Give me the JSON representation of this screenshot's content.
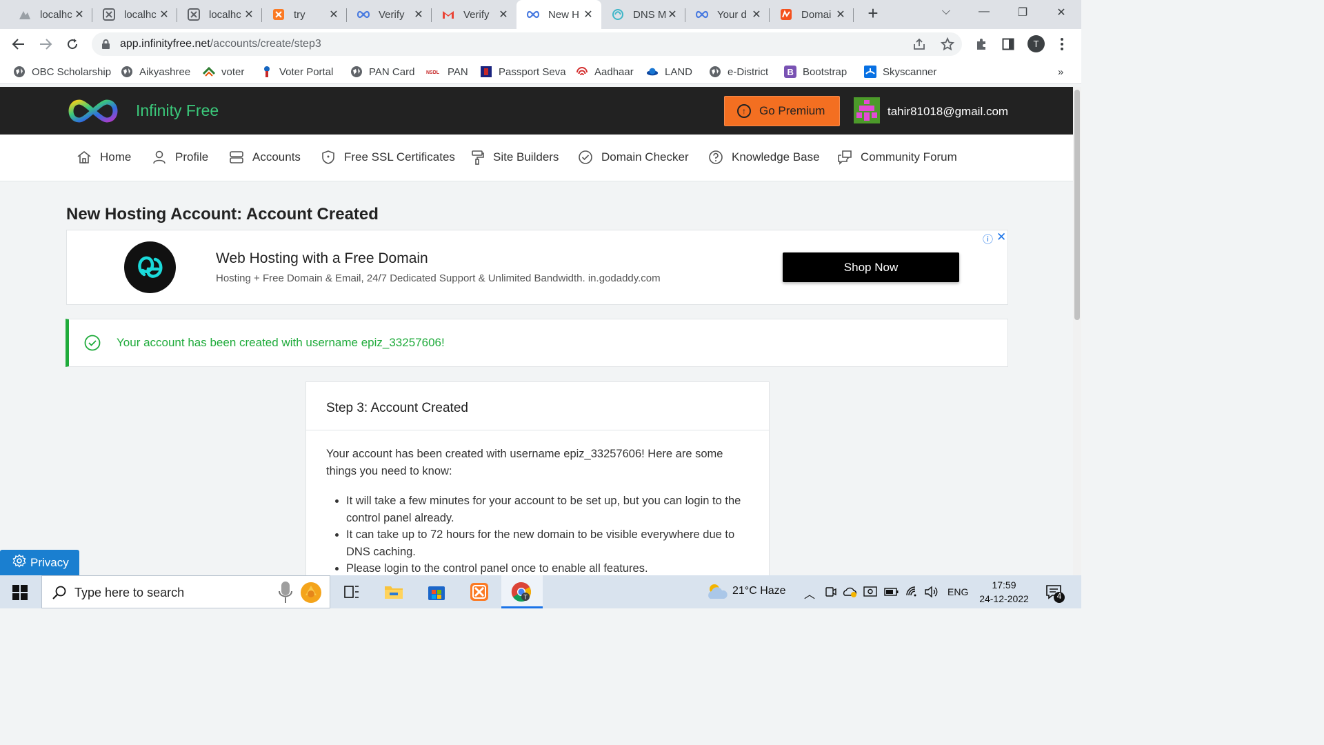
{
  "browser": {
    "tabs": [
      {
        "label": "localhc",
        "icon": "pma-icon"
      },
      {
        "label": "localhc",
        "icon": "xampp-icon"
      },
      {
        "label": "localhc",
        "icon": "xampp-icon"
      },
      {
        "label": "try",
        "icon": "xampp-orange-icon"
      },
      {
        "label": "Verify",
        "icon": "infinity-icon"
      },
      {
        "label": "Verify",
        "icon": "gmail-icon"
      },
      {
        "label": "New H",
        "icon": "infinity-icon",
        "active": true
      },
      {
        "label": "DNS M",
        "icon": "dns-icon"
      },
      {
        "label": "Your d",
        "icon": "infinity-icon"
      },
      {
        "label": "Domai",
        "icon": "domain-icon"
      }
    ],
    "url_host": "app.infinityfree.net",
    "url_path": "/accounts/create/step3",
    "profile_initial": "T",
    "bookmarks": [
      "OBC Scholarship",
      "Aikyashree",
      "voter",
      "Voter Portal",
      "PAN Card",
      "PAN",
      "Passport Seva",
      "Aadhaar",
      "LAND",
      "e-District",
      "Bootstrap",
      "Skyscanner"
    ],
    "bookmarks_overflow": "»"
  },
  "site": {
    "brand": "Infinity Free",
    "premium_label": "Go Premium",
    "user_email": "tahir81018@gmail.com",
    "nav": [
      "Home",
      "Profile",
      "Accounts",
      "Free SSL Certificates",
      "Site Builders",
      "Domain Checker",
      "Knowledge Base",
      "Community Forum"
    ]
  },
  "main": {
    "page_title": "New Hosting Account: Account Created",
    "ad": {
      "title": "Web Hosting with a Free Domain",
      "subtitle": "Hosting + Free Domain & Email, 24/7 Dedicated Support & Unlimited Bandwidth. in.godaddy.com",
      "button": "Shop Now"
    },
    "alert_text": "Your account has been created with username epiz_33257606!",
    "card": {
      "title": "Step 3: Account Created",
      "intro": "Your account has been created with username epiz_33257606! Here are some things you need to know:",
      "items": [
        "It will take a few minutes for your account to be set up, but you can login to the control panel already.",
        "It can take up to 72 hours for the new domain to be visible everywhere due to DNS caching.",
        "Please login to the control panel once to enable all features."
      ]
    },
    "privacy_label": "Privacy"
  },
  "taskbar": {
    "search_placeholder": "Type here to search",
    "weather": "21°C  Haze",
    "language": "ENG",
    "time": "17:59",
    "date": "24-12-2022",
    "notification_count": "4"
  },
  "colors": {
    "brand_green": "#3bc97b",
    "premium_orange": "#f36f21",
    "success_green": "#1fab3b",
    "header_dark": "#222222",
    "privacy_blue": "#1a7fd0"
  }
}
